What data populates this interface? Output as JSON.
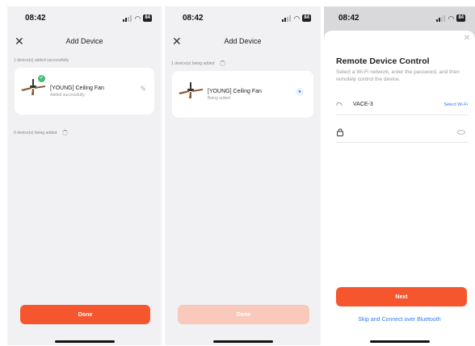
{
  "screen1": {
    "status_time": "08:42",
    "battery": "84",
    "title": "Add Device",
    "success_section": "1 device(s) added successfully",
    "device_name": "[YOUNG] Ceiling Fan",
    "device_status": "Added successfully",
    "adding_section": "0 device(s) being added",
    "done_label": "Done",
    "done_color": "#f6562d"
  },
  "screen2": {
    "status_time": "08:42",
    "battery": "84",
    "title": "Add Device",
    "adding_section": "1 device(s) being added",
    "device_name": "[YOUNG] Ceiling Fan",
    "device_status": "Being added",
    "done_label": "Done",
    "done_disabled_color": "#f9c9bc"
  },
  "screen3": {
    "status_time": "08:42",
    "battery": "84",
    "title": "Remote Device Control",
    "description": "Select a Wi-Fi network, enter the password, and then remotely control the device.",
    "wifi_name": "VACE-3",
    "select_wifi_label": "Select Wi-Fi",
    "password_value": "",
    "password_placeholder": "",
    "next_label": "Next",
    "next_color": "#f6562d",
    "skip_label": "Skip and Connect over Bluetooth",
    "link_color": "#2f7cf6"
  }
}
